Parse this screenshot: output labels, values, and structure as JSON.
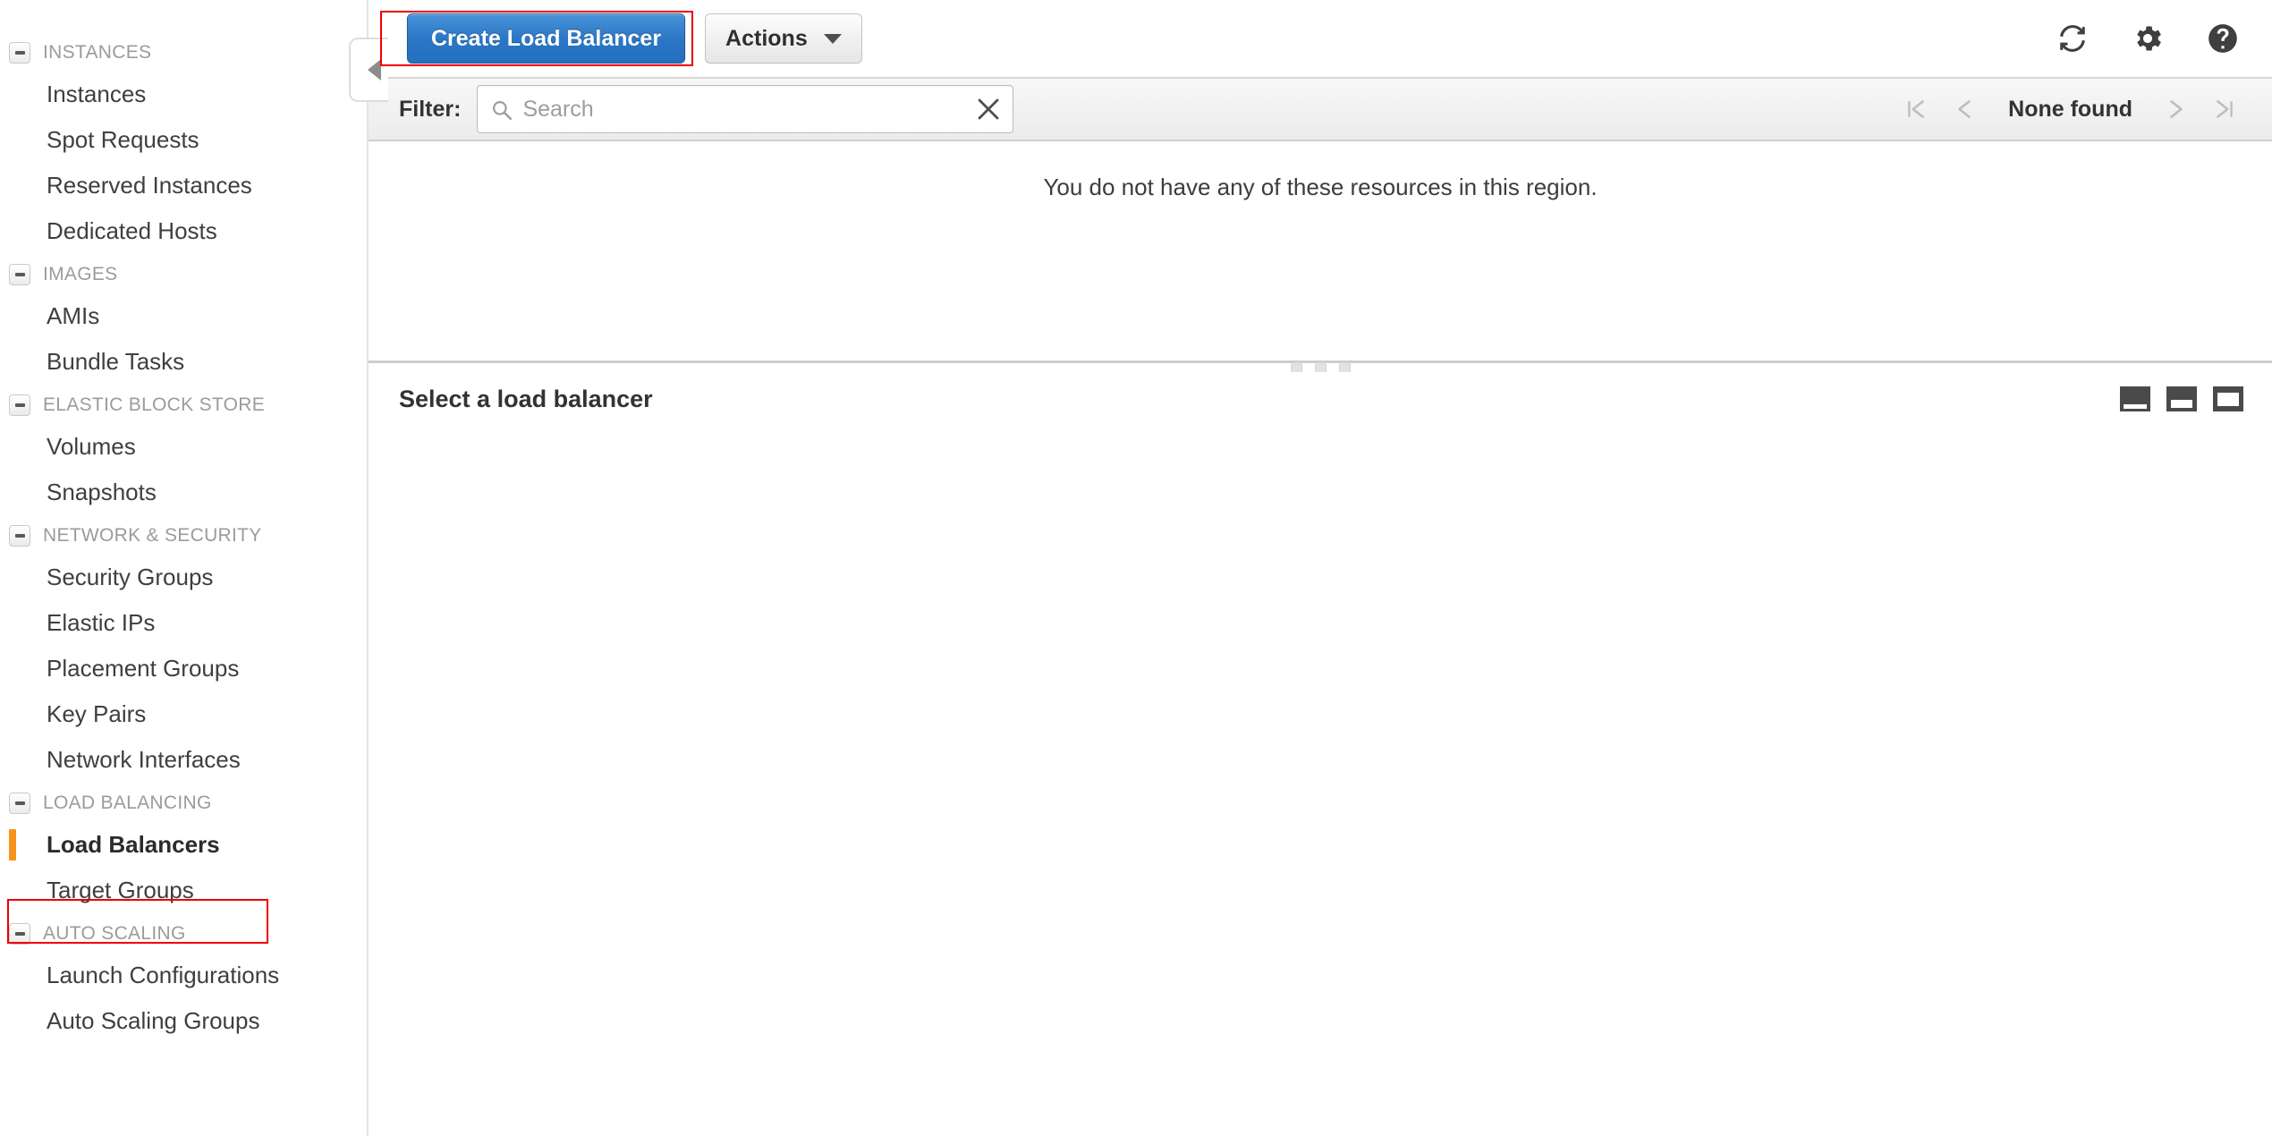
{
  "sidebar": {
    "sections": [
      {
        "id": "instances",
        "label": "INSTANCES",
        "items": [
          {
            "label": "Instances",
            "selected": false
          },
          {
            "label": "Spot Requests",
            "selected": false
          },
          {
            "label": "Reserved Instances",
            "selected": false
          },
          {
            "label": "Dedicated Hosts",
            "selected": false
          }
        ]
      },
      {
        "id": "images",
        "label": "IMAGES",
        "items": [
          {
            "label": "AMIs",
            "selected": false
          },
          {
            "label": "Bundle Tasks",
            "selected": false
          }
        ]
      },
      {
        "id": "elastic-block-store",
        "label": "ELASTIC BLOCK STORE",
        "items": [
          {
            "label": "Volumes",
            "selected": false
          },
          {
            "label": "Snapshots",
            "selected": false
          }
        ]
      },
      {
        "id": "network-security",
        "label": "NETWORK & SECURITY",
        "items": [
          {
            "label": "Security Groups",
            "selected": false
          },
          {
            "label": "Elastic IPs",
            "selected": false
          },
          {
            "label": "Placement Groups",
            "selected": false
          },
          {
            "label": "Key Pairs",
            "selected": false
          },
          {
            "label": "Network Interfaces",
            "selected": false
          }
        ]
      },
      {
        "id": "load-balancing",
        "label": "LOAD BALANCING",
        "items": [
          {
            "label": "Load Balancers",
            "selected": true
          },
          {
            "label": "Target Groups",
            "selected": false
          }
        ]
      },
      {
        "id": "auto-scaling",
        "label": "AUTO SCALING",
        "items": [
          {
            "label": "Launch Configurations",
            "selected": false
          },
          {
            "label": "Auto Scaling Groups",
            "selected": false
          }
        ]
      }
    ]
  },
  "toolbar": {
    "collapse_icon": "caret-left-icon",
    "create_label": "Create Load Balancer",
    "actions_label": "Actions",
    "icons": [
      {
        "name": "refresh-icon"
      },
      {
        "name": "gear-icon"
      },
      {
        "name": "help-icon"
      }
    ]
  },
  "filter": {
    "label": "Filter:",
    "placeholder": "Search",
    "value": "",
    "clear_icon": "close-icon"
  },
  "pagination": {
    "first_icon": "first-page-icon",
    "prev_icon": "prev-page-icon",
    "status": "None found",
    "next_icon": "next-page-icon",
    "last_icon": "last-page-icon"
  },
  "resources": {
    "empty_message": "You do not have any of these resources in this region."
  },
  "detail": {
    "title": "Select a load balancer",
    "size_icons": [
      {
        "name": "panel-size-small-icon"
      },
      {
        "name": "panel-size-medium-icon"
      },
      {
        "name": "panel-size-large-icon"
      }
    ]
  },
  "annotations": {
    "accent_color": "#ee0000",
    "selected_marker_color": "#f6931e"
  }
}
